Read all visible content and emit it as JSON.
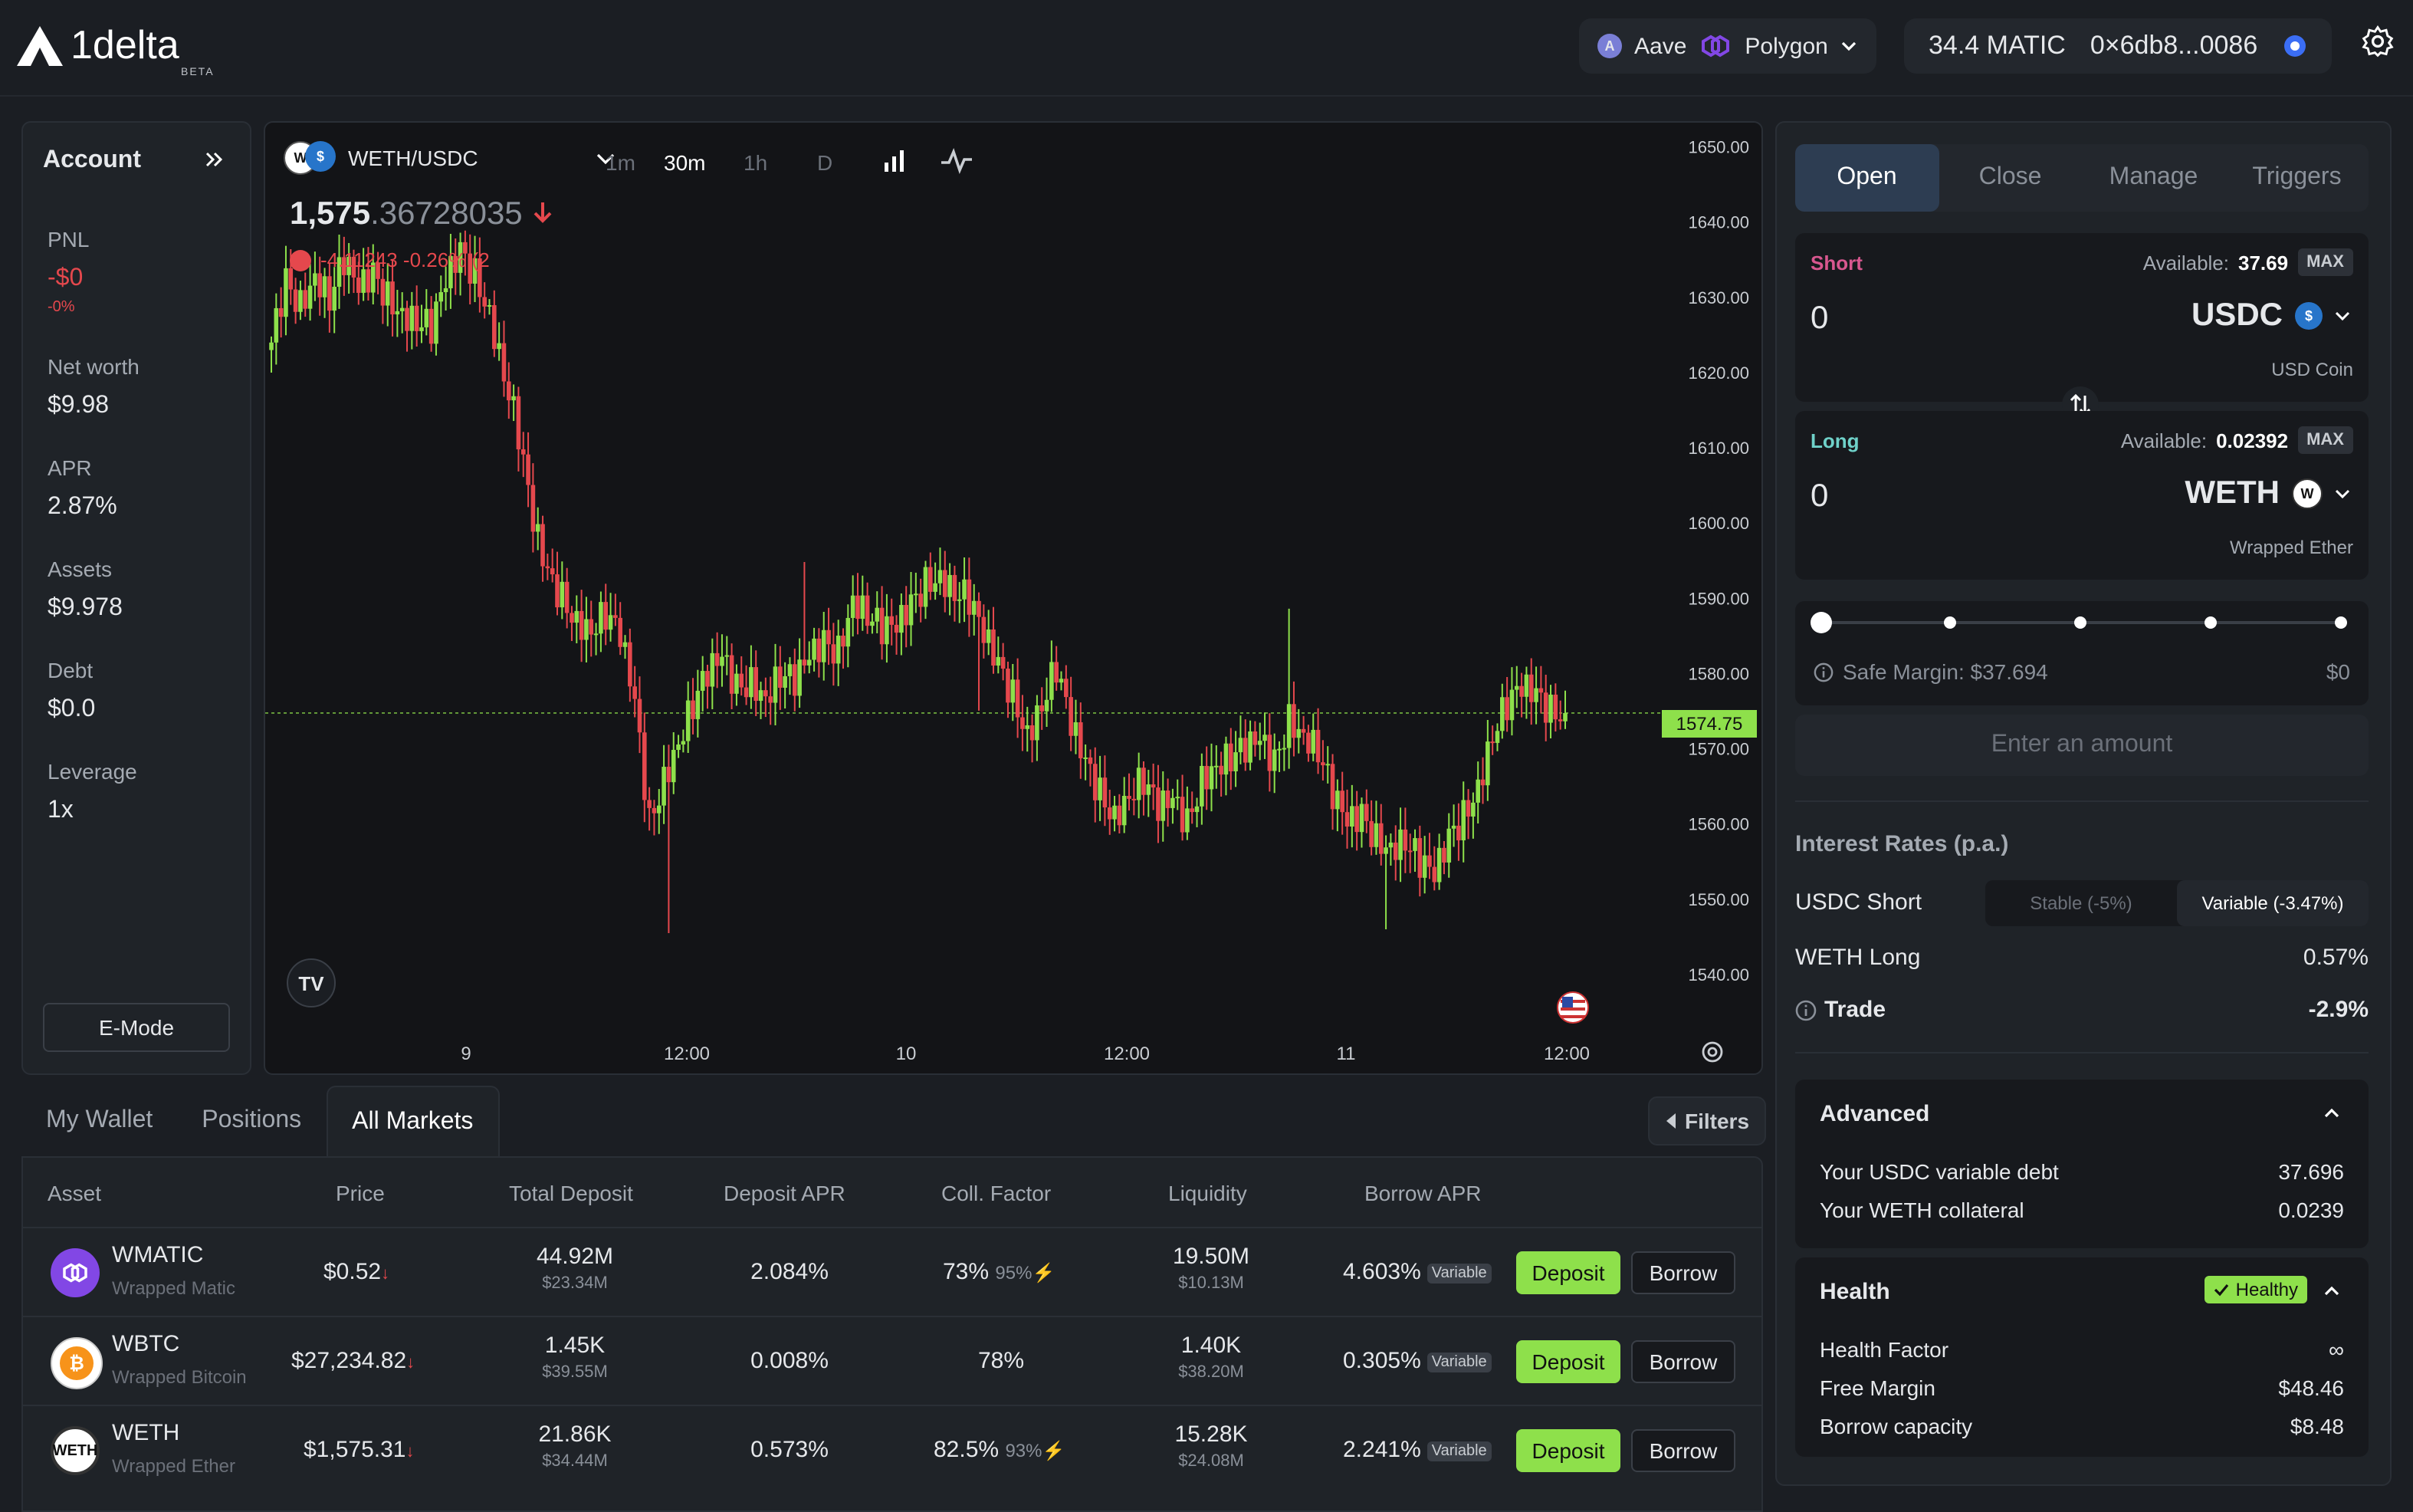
{
  "header": {
    "logo_text": "1delta",
    "beta": "BETA",
    "protocol": "Aave",
    "network": "Polygon",
    "balance": "34.4 MATIC",
    "address": "0×6db8...0086"
  },
  "account": {
    "title": "Account",
    "items": [
      {
        "label": "PNL",
        "value": "-$0",
        "sub": "-0%"
      },
      {
        "label": "Net worth",
        "value": "$9.98"
      },
      {
        "label": "APR",
        "value": "2.87%"
      },
      {
        "label": "Assets",
        "value": "$9.978"
      },
      {
        "label": "Debt",
        "value": "$0.0"
      },
      {
        "label": "Leverage",
        "value": "1x"
      }
    ],
    "emode": "E-Mode"
  },
  "chart": {
    "pair": "WETH/USDC",
    "timeframes": [
      "1m",
      "30m",
      "1h",
      "D"
    ],
    "active_timeframe": "30m",
    "price_int": "1,575",
    "price_frac": ".36728035",
    "ohlc_text": "-4.11243 -0.26% (2",
    "tv_logo": "TV",
    "last_price_label": "1574.75"
  },
  "chart_data": {
    "type": "candlestick",
    "yaxis_ticks": [
      "1650.00",
      "1640.00",
      "1630.00",
      "1620.00",
      "1610.00",
      "1600.00",
      "1590.00",
      "1580.00",
      "1570.00",
      "1560.00",
      "1550.00",
      "1540.00"
    ],
    "ylim": [
      1535,
      1652
    ],
    "xaxis_ticks": [
      "9",
      "12:00",
      "10",
      "12:00",
      "11",
      "12:00"
    ],
    "last_price": 1574.75,
    "approx_close_path": [
      1624,
      1632,
      1629,
      1633,
      1630,
      1635,
      1631,
      1633,
      1630,
      1628,
      1627,
      1626,
      1632,
      1636,
      1633,
      1628,
      1620,
      1612,
      1600,
      1593,
      1590,
      1587,
      1586,
      1588,
      1585,
      1576,
      1560,
      1566,
      1571,
      1576,
      1580,
      1582,
      1578,
      1579,
      1577,
      1580,
      1579,
      1582,
      1584,
      1583,
      1590,
      1588,
      1586,
      1586,
      1589,
      1592,
      1593,
      1591,
      1590,
      1585,
      1581,
      1577,
      1572,
      1576,
      1581,
      1573,
      1568,
      1564,
      1561,
      1564,
      1566,
      1562,
      1563,
      1560,
      1566,
      1568,
      1569,
      1570,
      1571,
      1568,
      1574,
      1572,
      1570,
      1564,
      1560,
      1561,
      1558,
      1557,
      1558,
      1555,
      1553,
      1558,
      1561,
      1565,
      1572,
      1576,
      1578,
      1577,
      1575,
      1574.75
    ]
  },
  "markets": {
    "tabs": [
      "My Wallet",
      "Positions",
      "All Markets"
    ],
    "active_tab": "All Markets",
    "filters": "Filters",
    "columns": [
      "Asset",
      "Price",
      "Total Deposit",
      "Deposit APR",
      "Coll. Factor",
      "Liquidity",
      "Borrow APR"
    ],
    "rows": [
      {
        "symbol": "WMATIC",
        "name": "Wrapped Matic",
        "price": "$0.52",
        "deposit": "44.92M",
        "deposit_usd": "$23.34M",
        "deposit_apr": "2.084%",
        "coll": "73%",
        "coll_emode": "95%",
        "liquidity": "19.50M",
        "liquidity_usd": "$10.13M",
        "borrow_apr": "4.603%",
        "badge": "Variable",
        "dep_btn": "Deposit",
        "bor_btn": "Borrow",
        "icon_color": "#8247e5"
      },
      {
        "symbol": "WBTC",
        "name": "Wrapped Bitcoin",
        "price": "$27,234.82",
        "deposit": "1.45K",
        "deposit_usd": "$39.55M",
        "deposit_apr": "0.008%",
        "coll": "78%",
        "coll_emode": "",
        "liquidity": "1.40K",
        "liquidity_usd": "$38.20M",
        "borrow_apr": "0.305%",
        "badge": "Variable",
        "dep_btn": "Deposit",
        "bor_btn": "Borrow",
        "icon_color": "#f7931a"
      },
      {
        "symbol": "WETH",
        "name": "Wrapped Ether",
        "price": "$1,575.31",
        "deposit": "21.86K",
        "deposit_usd": "$34.44M",
        "deposit_apr": "0.573%",
        "coll": "82.5%",
        "coll_emode": "93%",
        "liquidity": "15.28K",
        "liquidity_usd": "$24.08M",
        "borrow_apr": "2.241%",
        "badge": "Variable",
        "dep_btn": "Deposit",
        "bor_btn": "Borrow",
        "icon_color": "#ffffff"
      }
    ]
  },
  "trade": {
    "tabs": [
      "Open",
      "Close",
      "Manage",
      "Triggers"
    ],
    "active_tab": "Open",
    "short": {
      "label": "Short",
      "available_label": "Available:",
      "available": "37.69",
      "max": "MAX",
      "amount": "0",
      "token": "USDC",
      "token_name": "USD Coin"
    },
    "long": {
      "label": "Long",
      "available_label": "Available:",
      "available": "0.02392",
      "max": "MAX",
      "amount": "0",
      "token": "WETH",
      "token_name": "Wrapped Ether"
    },
    "slider_value": 0,
    "safe_margin": "Safe Margin: $37.694",
    "safe_margin_right": "$0",
    "enter_amount": "Enter an amount",
    "interest_title": "Interest Rates (p.a.)",
    "usdc_short": "USDC Short",
    "stable": "Stable (-5%)",
    "variable": "Variable (-3.47%)",
    "weth_long": "WETH Long",
    "weth_long_value": "0.57%",
    "trade_label": "Trade",
    "trade_value": "-2.9%",
    "advanced": {
      "title": "Advanced",
      "debt_label": "Your USDC variable debt",
      "debt": "37.696",
      "coll_label": "Your WETH collateral",
      "coll": "0.0239"
    },
    "health": {
      "title": "Health",
      "badge": "Healthy",
      "factor_label": "Health Factor",
      "factor": "∞",
      "margin_label": "Free Margin",
      "margin": "$48.46",
      "capacity_label": "Borrow capacity",
      "capacity": "$8.48"
    }
  },
  "colors": {
    "accent_green": "#8ee04b",
    "down_red": "#e5484d",
    "short_label": "#d8578f",
    "long_label": "#6fd1c9"
  }
}
